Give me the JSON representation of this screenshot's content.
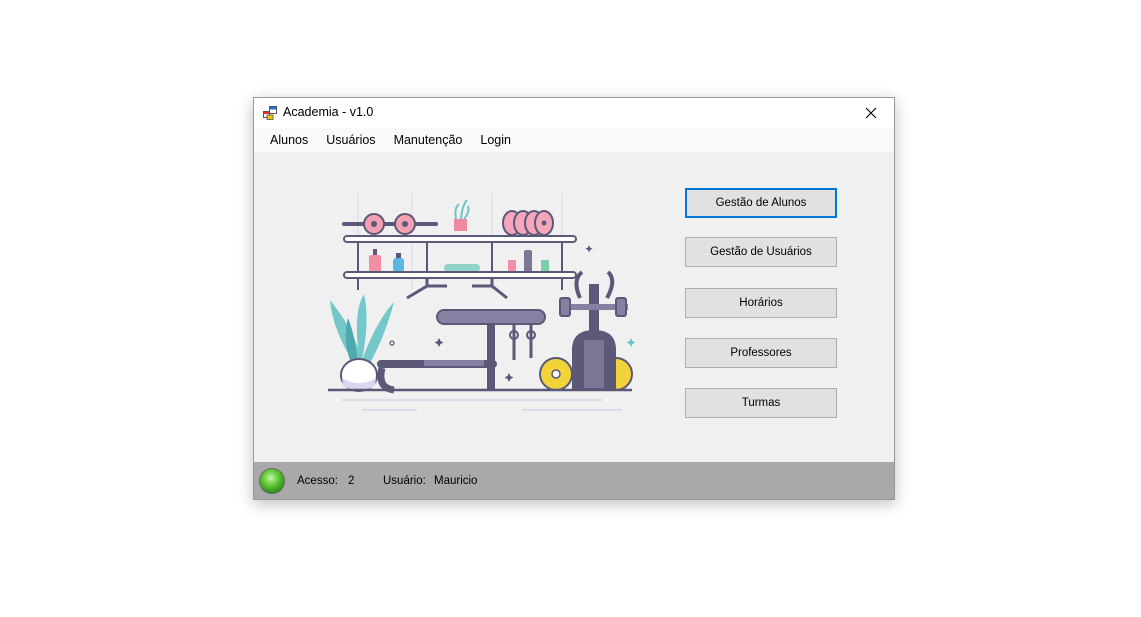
{
  "window": {
    "title": "Academia - v1.0"
  },
  "menu": {
    "items": [
      "Alunos",
      "Usuários",
      "Manutenção",
      "Login"
    ]
  },
  "buttons": {
    "gestao_alunos": "Gestão de Alunos",
    "gestao_usuarios": "Gestão de Usuários",
    "horarios": "Horários",
    "professores": "Professores",
    "turmas": "Turmas"
  },
  "status": {
    "acesso_label": "Acesso:",
    "acesso_value": "2",
    "usuario_label": "Usuário:",
    "usuario_value": "Mauricio"
  },
  "colors": {
    "focus": "#0078d7",
    "status_bg": "#a9a9a9",
    "led": "#62c93a"
  }
}
